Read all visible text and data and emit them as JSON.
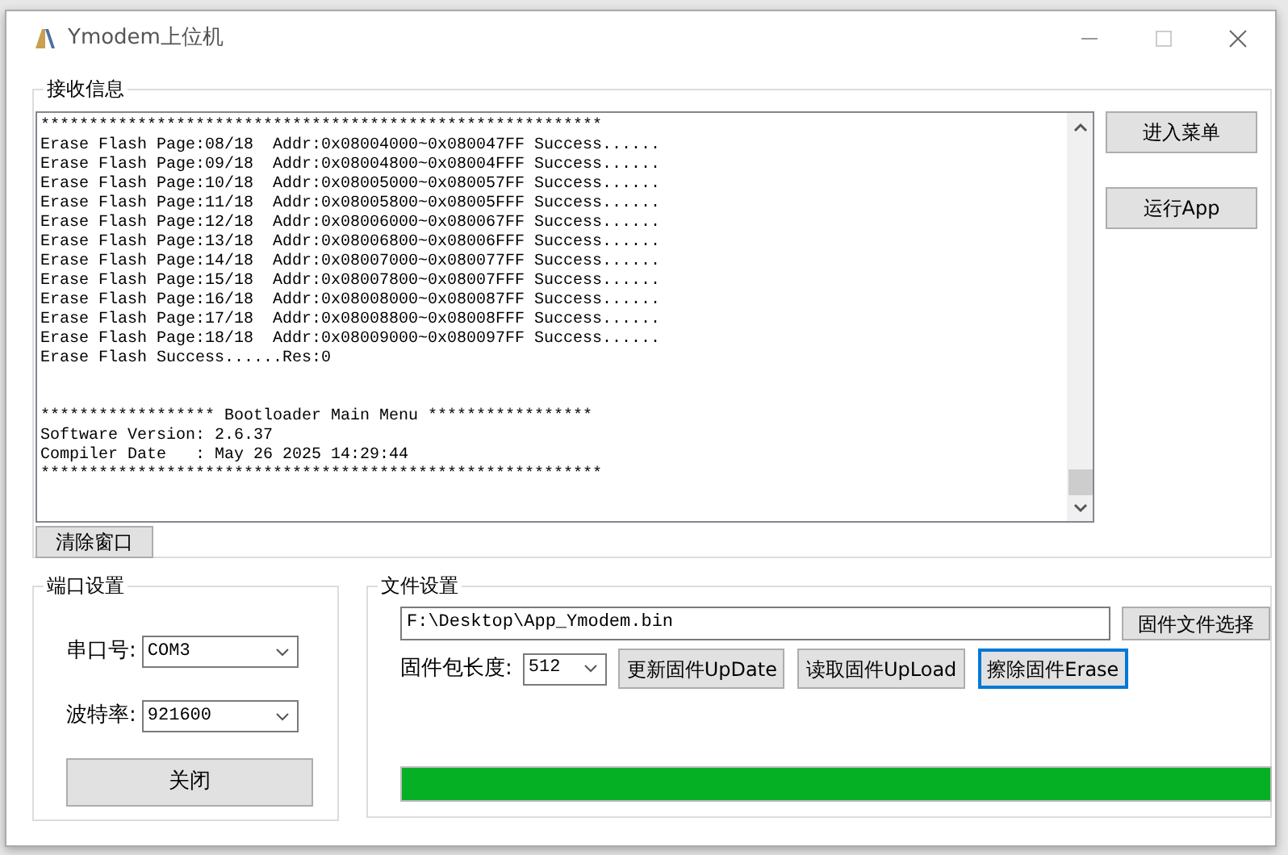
{
  "window": {
    "title": "Ymodem上位机"
  },
  "receive_group": {
    "title": "接收信息",
    "log_blocks": [
      [
        "**********************************************************",
        "Erase Flash Page:08/18  Addr:0x08004000~0x080047FF Success......",
        "Erase Flash Page:09/18  Addr:0x08004800~0x08004FFF Success......",
        "Erase Flash Page:10/18  Addr:0x08005000~0x080057FF Success......",
        "Erase Flash Page:11/18  Addr:0x08005800~0x08005FFF Success......",
        "Erase Flash Page:12/18  Addr:0x08006000~0x080067FF Success......",
        "Erase Flash Page:13/18  Addr:0x08006800~0x08006FFF Success......",
        "Erase Flash Page:14/18  Addr:0x08007000~0x080077FF Success......",
        "Erase Flash Page:15/18  Addr:0x08007800~0x08007FFF Success......",
        "Erase Flash Page:16/18  Addr:0x08008000~0x080087FF Success......",
        "Erase Flash Page:17/18  Addr:0x08008800~0x08008FFF Success......",
        "Erase Flash Page:18/18  Addr:0x08009000~0x080097FF Success......",
        "Erase Flash Success......Res:0"
      ],
      [
        "****************** Bootloader Main Menu *****************",
        "Software Version: 2.6.37",
        "Compiler Date   : May 26 2025 14:29:44",
        "**********************************************************"
      ]
    ],
    "side_buttons": [
      "进入菜单",
      "运行App"
    ],
    "clear_button": "清除窗口"
  },
  "port_group": {
    "title": "端口设置",
    "fields": [
      {
        "label": "串口号:",
        "value": "COM3"
      },
      {
        "label": "波特率:",
        "value": "921600"
      }
    ],
    "button": "关闭"
  },
  "file_group": {
    "title": "文件设置",
    "file_path": "F:\\Desktop\\App_Ymodem.bin",
    "choose_button": "固件文件选择",
    "packet_label": "固件包长度:",
    "packet_value": "512",
    "buttons": [
      {
        "label": "更新固件UpDate",
        "focused": false
      },
      {
        "label": "读取固件UpLoad",
        "focused": false
      },
      {
        "label": "擦除固件Erase",
        "focused": true
      }
    ],
    "progress": {
      "level": 1
    }
  }
}
